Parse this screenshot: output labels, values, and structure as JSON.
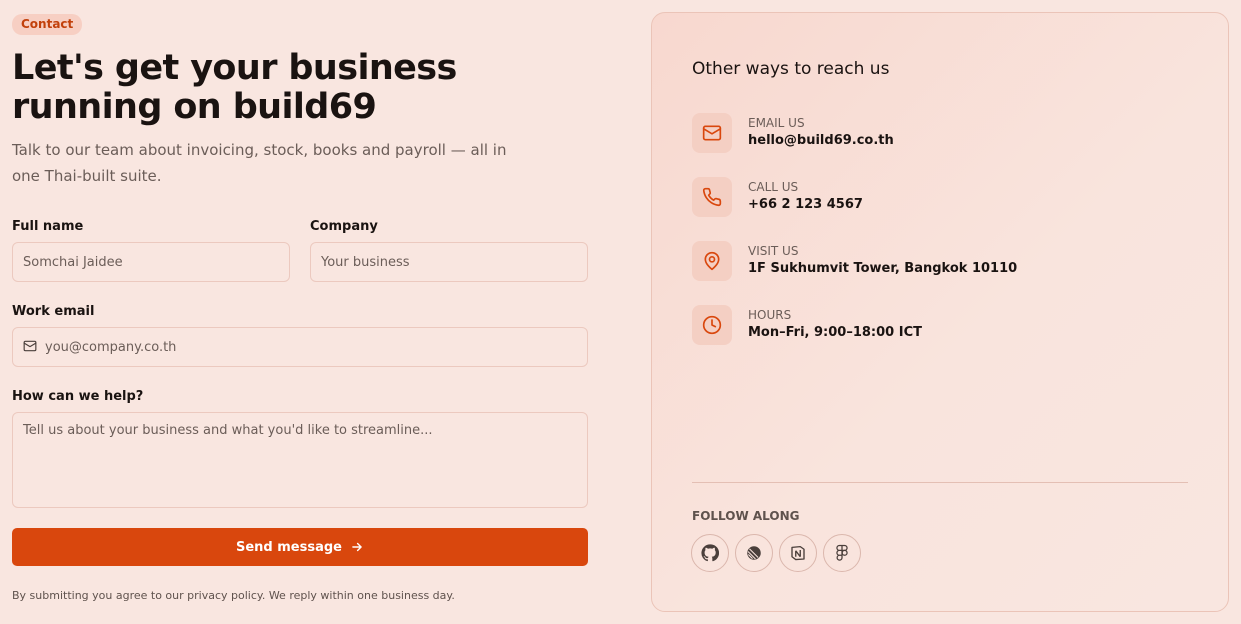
{
  "form": {
    "badge": "Contact",
    "title": "Let's get your business running on build69",
    "subtitle": "Talk to our team about invoicing, stock, books and payroll — all in one Thai-built suite.",
    "full_name": {
      "label": "Full name",
      "placeholder": "Somchai Jaidee"
    },
    "company": {
      "label": "Company",
      "placeholder": "Your business"
    },
    "work_email": {
      "label": "Work email",
      "placeholder": "you@company.co.th"
    },
    "help": {
      "label": "How can we help?",
      "placeholder": "Tell us about your business and what you'd like to streamline..."
    },
    "submit_label": "Send message",
    "disclaimer": "By submitting you agree to our privacy policy. We reply within one business day."
  },
  "contact": {
    "title": "Other ways to reach us",
    "items": [
      {
        "key": "EMAIL US",
        "value": "hello@build69.co.th",
        "icon": "mail-icon"
      },
      {
        "key": "CALL US",
        "value": "+66 2 123 4567",
        "icon": "phone-icon"
      },
      {
        "key": "VISIT US",
        "value": "1F Sukhumvit Tower, Bangkok 10110",
        "icon": "map-pin-icon"
      },
      {
        "key": "HOURS",
        "value": "Mon–Fri, 9:00–18:00 ICT",
        "icon": "clock-icon"
      }
    ],
    "follow_label": "FOLLOW ALONG",
    "socials": [
      "github-icon",
      "linear-icon",
      "notion-icon",
      "figma-icon"
    ]
  },
  "colors": {
    "accent": "#d9470d",
    "background": "#f9e6e0",
    "icon_bg": "#f4cfc3"
  }
}
